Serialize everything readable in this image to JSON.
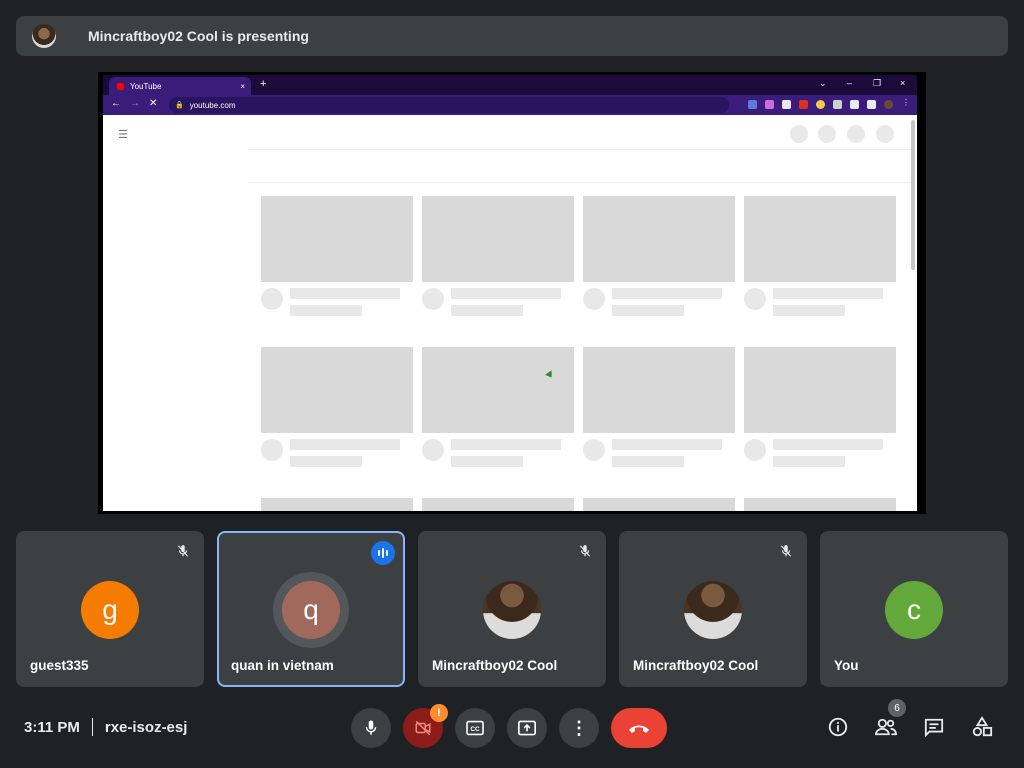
{
  "presenting": {
    "text": "Mincraftboy02 Cool is presenting"
  },
  "browser": {
    "tab_title": "YouTube",
    "tab_close": "×",
    "new_tab": "+",
    "url": "youtube.com",
    "window_controls": [
      "⌄",
      "–",
      "❐",
      "×"
    ],
    "nav": [
      "←",
      "→",
      "✕"
    ]
  },
  "participants": [
    {
      "name": "guest335",
      "initial": "g",
      "color": "#f57c00",
      "muted": true,
      "speaking": false
    },
    {
      "name": "quan in vietnam",
      "initial": "q",
      "color": "#a1695c",
      "muted": false,
      "speaking": true
    },
    {
      "name": "Mincraftboy02 Cool",
      "initial": "",
      "color": "",
      "muted": true,
      "speaking": false
    },
    {
      "name": "Mincraftboy02 Cool",
      "initial": "",
      "color": "",
      "muted": true,
      "speaking": false
    },
    {
      "name": "You",
      "initial": "c",
      "color": "#62a83a",
      "muted": false,
      "speaking": false
    }
  ],
  "meeting": {
    "time": "3:11 PM",
    "code": "rxe-isoz-esj"
  },
  "controls": {
    "camera_warning": "!",
    "people_count": "6"
  },
  "icons": {
    "mic": "mic-icon",
    "camera_off": "videocam-off-icon",
    "captions": "closed-caption-icon",
    "present": "present-screen-icon",
    "more": "more-vert-icon",
    "end": "call-end-icon",
    "info": "info-icon",
    "people": "people-icon",
    "chat": "chat-icon",
    "activities": "activities-icon"
  },
  "colors": {
    "background": "#202124",
    "tile": "#3c4043",
    "end_call": "#ea4335",
    "speaking_border": "#8ab4f8",
    "browser_accent": "#3a1d7a"
  }
}
